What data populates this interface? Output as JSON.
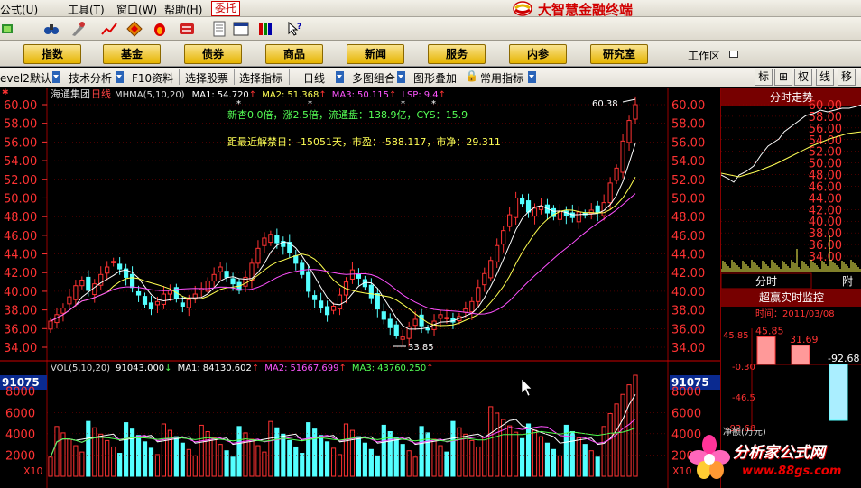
{
  "menubar": {
    "items": [
      "公式(U)",
      "工具(T)",
      "窗口(W)",
      "帮助(H)"
    ],
    "weituo": "委托",
    "brand": "大智慧金融终端"
  },
  "toolbar": {
    "icons": [
      "back-icon",
      "binoculars-icon",
      "tools-icon",
      "trend-icon",
      "diamond-icon",
      "fire-icon",
      "exchange-icon",
      "document-icon",
      "window-icon",
      "books-icon",
      "help-cursor-icon"
    ]
  },
  "nav": {
    "buttons": [
      "指数",
      "基金",
      "债券",
      "商品",
      "新闻",
      "服务",
      "内参",
      "研究室"
    ],
    "workarea": "工作区"
  },
  "funcbar": {
    "level2": "evel2默认",
    "tech": "技术分析",
    "f10": "F10资料",
    "select_stock": "选择股票",
    "select_indicator": "选择指标",
    "period": "日线",
    "multi": "多图组合",
    "overlay": "图形叠加",
    "common": "常用指标",
    "tabs": [
      "标",
      "⊞",
      "权",
      "线",
      "移"
    ]
  },
  "chart": {
    "stock_name": "海通集团",
    "period_label": "日线",
    "ma_prefix": "MHMA(5,10,20)",
    "ma1_label": "MA1:",
    "ma1": "54.720",
    "ma2_label": "MA2:",
    "ma2": "51.368",
    "ma3_label": "MA3:",
    "ma3": "50.115",
    "lsp_label": "LSP:",
    "lsp": "9.4",
    "info1": "新杏0.0倍，涨2.5倍，流通盘：138.9亿，CYS：15.9",
    "info2": "距最近解禁日：-15051天，市盈：-588.117，市净：29.311",
    "high_mark": "60.38",
    "low_mark": "33.85",
    "price_ticks": [
      "60.00",
      "58.00",
      "56.00",
      "54.00",
      "52.00",
      "50.00",
      "48.00",
      "46.00",
      "44.00",
      "42.00",
      "40.00",
      "38.00",
      "36.00",
      "34.00"
    ],
    "vol_header": "VOL(5,10,20)",
    "vol_value": "91043.000",
    "vol_ma1_label": "MA1:",
    "vol_ma1": "84130.602",
    "vol_ma2_label": "MA2:",
    "vol_ma2": "51667.699",
    "vol_ma3_label": "MA3:",
    "vol_ma3": "43760.250",
    "vol_top": "91075",
    "vol_ticks": [
      "8000",
      "6000",
      "4000",
      "2000"
    ],
    "vol_unit": "X10"
  },
  "right_panel": {
    "timeshare_title": "分时走势",
    "price_ticks": [
      "60.00",
      "58.00",
      "56.00",
      "54.00",
      "52.00",
      "50.00",
      "48.00",
      "46.00",
      "44.00",
      "42.00",
      "40.00",
      "38.00",
      "36.00",
      "34.00"
    ],
    "tab_fenshi": "分时",
    "tab_fu": "附",
    "monitor_title": "超赢实时监控",
    "time_label": "时间：2011/03/08",
    "bars": [
      "45.85",
      "31.69",
      "-92.68"
    ],
    "axis": [
      "45.85",
      "-0.30",
      "-46.5",
      "-92.68"
    ],
    "net_label": "净额(万元)",
    "vol_top": "91075",
    "vol_ticks": [
      "8000",
      "6000",
      "4000",
      "2000"
    ]
  },
  "watermark": {
    "title": "分析家公式网",
    "url": "www.88gs.com"
  },
  "colors": {
    "up": "#ff3232",
    "down": "#54ffff",
    "ma1": "#ffffff",
    "ma2": "#ffff50",
    "ma3": "#ff50ff",
    "grid": "#900000",
    "nav_button": "#f2c200"
  },
  "chart_data": {
    "type": "candlestick",
    "closes": [
      36.8,
      37.5,
      38.2,
      39.4,
      40.6,
      41.2,
      40.1,
      40.8,
      41.8,
      42.6,
      43.2,
      42.4,
      41.5,
      40.4,
      39.6,
      38.6,
      38.1,
      38.9,
      39.7,
      40.1,
      39.2,
      38.4,
      39.1,
      39.7,
      40.3,
      41.1,
      41.8,
      42.6,
      41.5,
      40.8,
      40.1,
      41.5,
      43.0,
      44.6,
      45.7,
      46.1,
      45.2,
      44.8,
      44.1,
      43.0,
      41.8,
      40.0,
      39.1,
      38.2,
      37.5,
      38.4,
      39.6,
      41.0,
      42.3,
      41.4,
      40.5,
      39.3,
      38.1,
      37.0,
      36.1,
      35.3,
      35.1,
      36.2,
      37.0,
      36.3,
      35.9,
      36.8,
      37.5,
      37.2,
      36.7,
      37.3,
      38.1,
      38.9,
      40.4,
      41.9,
      43.3,
      44.9,
      46.5,
      48.2,
      50.0,
      49.4,
      48.5,
      48.9,
      49.1,
      48.4,
      48.0,
      48.6,
      48.1,
      47.9,
      48.5,
      48.2,
      48.7,
      48.4,
      49.5,
      51.6,
      53.2,
      56.1,
      58.3,
      60.0
    ]
  }
}
